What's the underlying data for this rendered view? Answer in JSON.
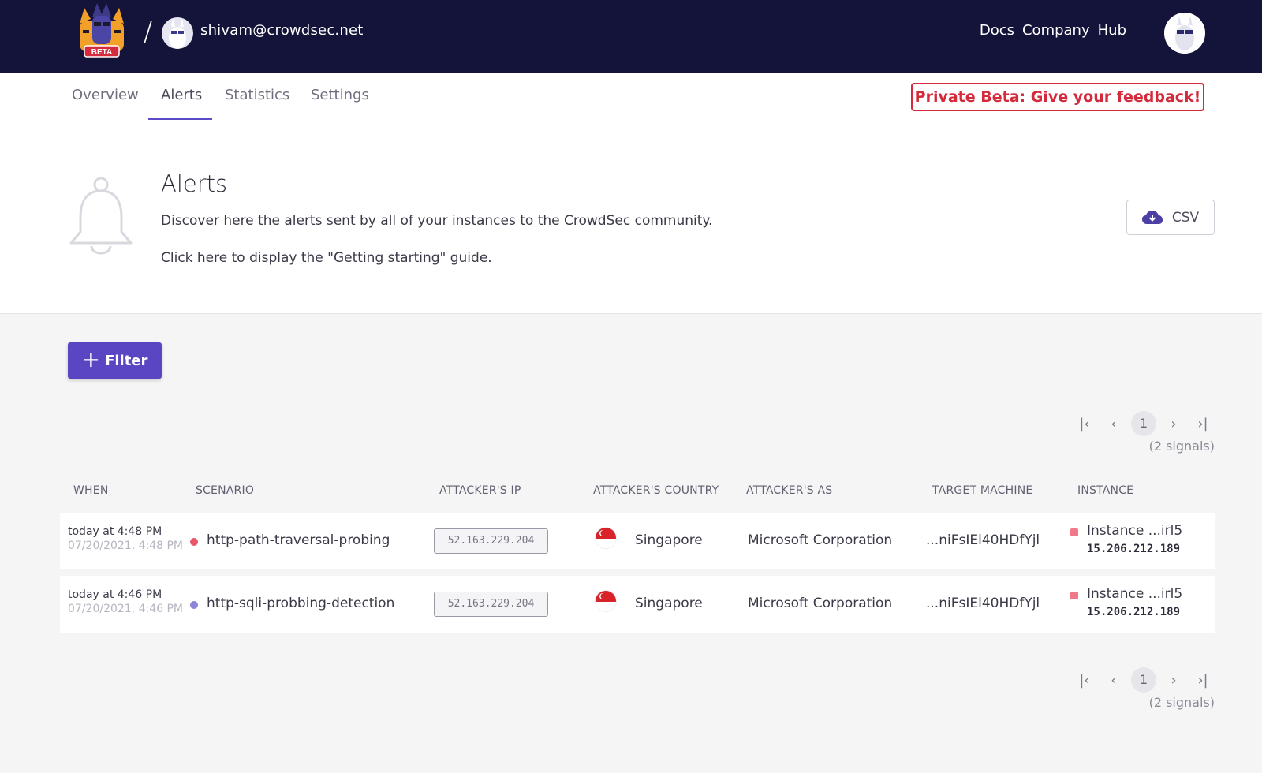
{
  "topbar": {
    "logo_badge": "BETA",
    "slash": "/",
    "user_email": "shivam@crowdsec.net",
    "links": [
      "Docs",
      "Company",
      "Hub"
    ]
  },
  "nav": {
    "tabs": [
      "Overview",
      "Alerts",
      "Statistics",
      "Settings"
    ],
    "active_tab": "Alerts",
    "feedback_label": "Private Beta: Give your feedback!"
  },
  "header": {
    "title": "Alerts",
    "description": "Discover here the alerts sent by all of your instances to the CrowdSec community.",
    "guide_link": "Click here to display the \"Getting starting\" guide.",
    "csv_label": "CSV"
  },
  "filter": {
    "label": "Filter"
  },
  "pagination": {
    "first": "|<",
    "prev": "<",
    "page": "1",
    "next": ">",
    "last": ">|",
    "signals": "(2 signals)"
  },
  "table": {
    "columns": [
      "WHEN",
      "SCENARIO",
      "ATTACKER'S IP",
      "ATTACKER'S COUNTRY",
      "ATTACKER'S AS",
      "TARGET MACHINE",
      "INSTANCE"
    ],
    "rows": [
      {
        "when": "today at 4:48 PM",
        "when_full": "07/20/2021, 4:48 PM",
        "scenario": "http-path-traversal-probing",
        "scenario_color": "#e8566a",
        "ip": "52.163.229.204",
        "country": "Singapore",
        "as": "Microsoft Corporation",
        "target": "...niFsIEl40HDfYjl",
        "instance": "Instance ...irl5",
        "instance_ip": "15.206.212.189"
      },
      {
        "when": "today at 4:46 PM",
        "when_full": "07/20/2021, 4:46 PM",
        "scenario": "http-sqli-probbing-detection",
        "scenario_color": "#8b86d8",
        "ip": "52.163.229.204",
        "country": "Singapore",
        "as": "Microsoft Corporation",
        "target": "...niFsIEl40HDfYjl",
        "instance": "Instance ...irl5",
        "instance_ip": "15.206.212.189"
      }
    ]
  },
  "colors": {
    "topbar_bg": "#14143a",
    "accent": "#5a46c2",
    "feedback_red": "#d42a3c"
  }
}
